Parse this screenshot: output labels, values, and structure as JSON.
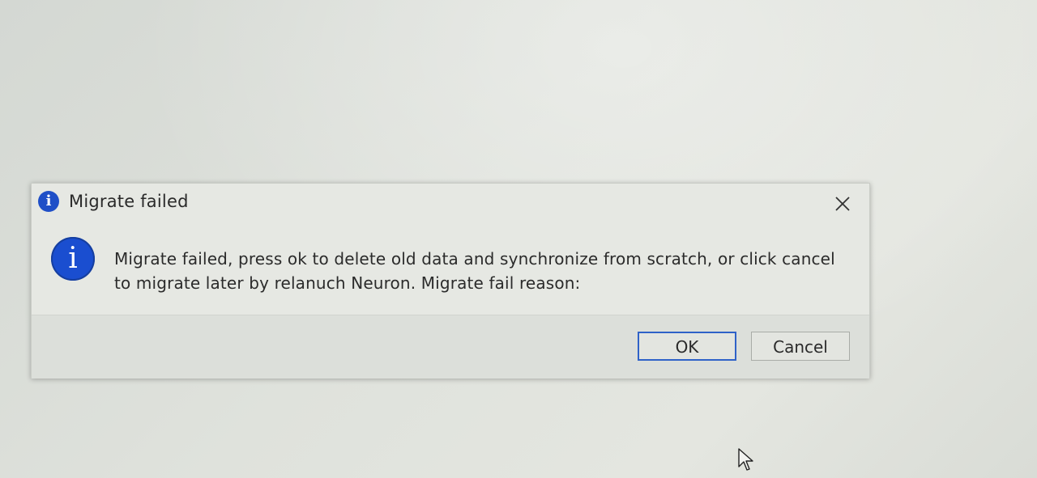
{
  "dialog": {
    "title": "Migrate failed",
    "title_icon": "info-icon",
    "message": "Migrate failed, press ok to delete old data and synchronize from scratch, or click cancel to migrate later by relanuch Neuron. Migrate fail reason:",
    "message_icon": "info-icon",
    "close_icon": "close-icon",
    "buttons": {
      "ok_label": "OK",
      "cancel_label": "Cancel"
    }
  },
  "colors": {
    "info_icon": "#1a4ed0",
    "ok_focus_border": "#2f62c8",
    "dialog_bg": "#e6e8e3",
    "footer_bg": "#dcdfda"
  },
  "cursor_icon": "pointer-arrow-icon"
}
